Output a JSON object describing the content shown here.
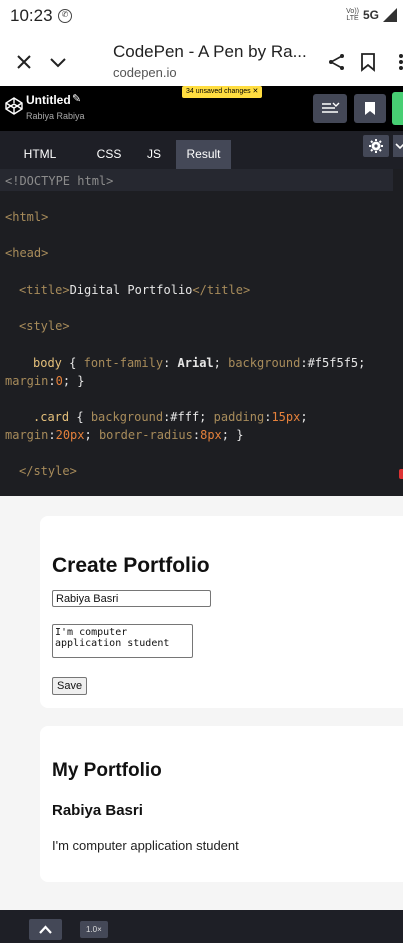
{
  "status_bar": {
    "time": "10:23",
    "whatsapp_icon": "whatsapp-icon",
    "volte_line1": "Vo))",
    "volte_line2": "LTE",
    "network": "5G",
    "signal_icon": "signal-icon"
  },
  "browser": {
    "title": "CodePen - A Pen by Ra...",
    "domain": "codepen.io",
    "close_icon": "close-icon",
    "chevron_icon": "chevron-down-icon",
    "share_icon": "share-icon",
    "bookmark_icon": "bookmark-icon",
    "more_icon": "more-icon"
  },
  "codepen_header": {
    "pen_title": "Untitled",
    "edit_icon": "pencil-icon",
    "pencil": "✎",
    "user": "Rabiya Rabiya",
    "unsaved_changes": "34 unsaved changes ✕",
    "brand_color": "#47cf73",
    "unsaved_color": "#ffdd40"
  },
  "tabs": [
    {
      "label": "HTML"
    },
    {
      "label": "CSS"
    },
    {
      "label": "JS"
    },
    {
      "label": "Result"
    }
  ],
  "code": {
    "line1": "<!DOCTYPE html>",
    "line2": "<html>",
    "line3": "<head>",
    "line4_open": "<title>",
    "line4_text": "Digital Portfolio",
    "line4_close": "</title>",
    "line5": "<style>",
    "line6a_sel": "body",
    "line6a_open": " { ",
    "line6a_prop1": "font-family",
    "line6a_colon1": ": ",
    "line6a_val1": "Arial",
    "line6a_semi1": "; ",
    "line6a_prop2": "background",
    "line6a_val2": ":#f5f5f5;",
    "line6b_prop": "margin",
    "line6b_colon": ":",
    "line6b_num": "0",
    "line6b_close": "; }",
    "line7a_sel": ".card",
    "line7a_open": " { ",
    "line7a_prop1": "background",
    "line7a_val1": ":#fff; ",
    "line7a_prop2": "padding",
    "line7a_colon2": ":",
    "line7a_num2": "15px",
    "line7a_semi2": ";",
    "line7b_prop1": "margin",
    "line7b_colon1": ":",
    "line7b_num1": "20px",
    "line7b_semi1": "; ",
    "line7b_prop2": "border-radius",
    "line7b_colon2": ":",
    "line7b_num2": "8px",
    "line7b_close": "; }",
    "line8": "</style>"
  },
  "result": {
    "form_heading": "Create Portfolio",
    "name_value": "Rabiya Basri",
    "about_value": "I'm computer application student",
    "save_label": "Save",
    "portfolio_heading": "My Portfolio",
    "portfolio_name": "Rabiya Basri",
    "portfolio_about": "I'm computer application student"
  },
  "bottom_bar": {
    "up_icon": "chevron-up-icon",
    "zoom": "1.0×"
  }
}
